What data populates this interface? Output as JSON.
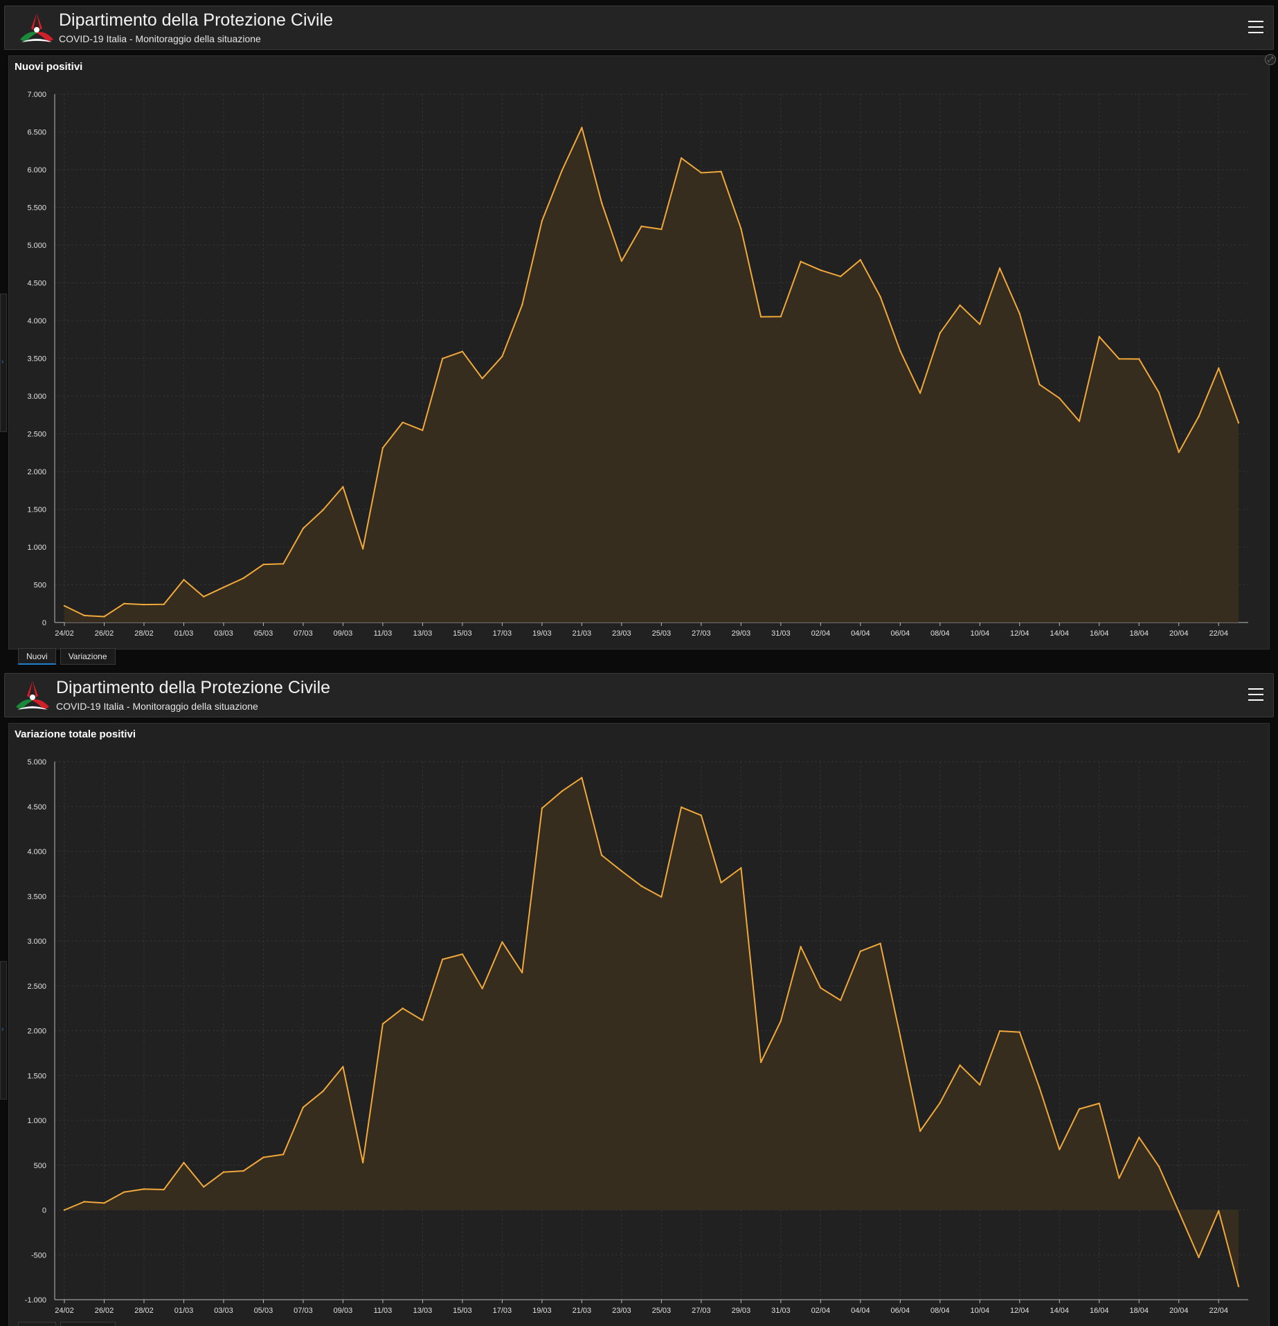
{
  "header": {
    "title": "Dipartimento della Protezione Civile",
    "subtitle": "COVID-19 Italia - Monitoraggio della situazione"
  },
  "tabs": [
    {
      "label": "Nuovi",
      "active": true
    },
    {
      "label": "Variazione",
      "active": false
    }
  ],
  "colors": {
    "line": "#f2a93b",
    "fill": "#3a2f1f",
    "background": "#212121",
    "grid": "#333333",
    "tab_active": "#1d7fd0"
  },
  "chart_data": [
    {
      "type": "area",
      "title": "Nuovi positivi",
      "xlabel": "",
      "ylabel": "",
      "ylim": [
        0,
        7000
      ],
      "ytick_step": 500,
      "grid": true,
      "x": [
        "24/02",
        "25/02",
        "26/02",
        "27/02",
        "28/02",
        "29/02",
        "01/03",
        "02/03",
        "03/03",
        "04/03",
        "05/03",
        "06/03",
        "07/03",
        "08/03",
        "09/03",
        "10/03",
        "11/03",
        "12/03",
        "13/03",
        "14/03",
        "15/03",
        "16/03",
        "17/03",
        "18/03",
        "19/03",
        "20/03",
        "21/03",
        "22/03",
        "23/03",
        "24/03",
        "25/03",
        "26/03",
        "27/03",
        "28/03",
        "29/03",
        "30/03",
        "31/03",
        "01/04",
        "02/04",
        "03/04",
        "04/04",
        "05/04",
        "06/04",
        "07/04",
        "08/04",
        "09/04",
        "10/04",
        "11/04",
        "12/04",
        "13/04",
        "14/04",
        "15/04",
        "16/04",
        "17/04",
        "18/04",
        "19/04",
        "20/04",
        "21/04",
        "22/04",
        "23/04"
      ],
      "xticklabels": [
        "24/02",
        "26/02",
        "28/02",
        "01/03",
        "03/03",
        "05/03",
        "07/03",
        "09/03",
        "11/03",
        "13/03",
        "15/03",
        "17/03",
        "19/03",
        "21/03",
        "23/03",
        "25/03",
        "27/03",
        "29/03",
        "31/03",
        "02/04",
        "04/04",
        "06/04",
        "08/04",
        "10/04",
        "12/04",
        "14/04",
        "16/04",
        "18/04",
        "20/04",
        "22/04"
      ],
      "series": [
        {
          "values": [
            221,
            93,
            78,
            250,
            238,
            240,
            566,
            342,
            466,
            587,
            769,
            778,
            1247,
            1492,
            1797,
            977,
            2313,
            2651,
            2547,
            3497,
            3590,
            3233,
            3526,
            4207,
            5322,
            5986,
            6557,
            5560,
            4789,
            5249,
            5210,
            6153,
            5959,
            5974,
            5217,
            4050,
            4053,
            4782,
            4668,
            4585,
            4805,
            4316,
            3599,
            3039,
            3836,
            4204,
            3951,
            4694,
            4092,
            3153,
            2972,
            2667,
            3786,
            3493,
            3491,
            3047,
            2256,
            2729,
            3370,
            2646
          ]
        }
      ]
    },
    {
      "type": "area",
      "title": "Variazione totale positivi",
      "xlabel": "",
      "ylabel": "",
      "ylim": [
        -1000,
        5000
      ],
      "ytick_step": 500,
      "grid": true,
      "x": [
        "24/02",
        "25/02",
        "26/02",
        "27/02",
        "28/02",
        "29/02",
        "01/03",
        "02/03",
        "03/03",
        "04/03",
        "05/03",
        "06/03",
        "07/03",
        "08/03",
        "09/03",
        "10/03",
        "11/03",
        "12/03",
        "13/03",
        "14/03",
        "15/03",
        "16/03",
        "17/03",
        "18/03",
        "19/03",
        "20/03",
        "21/03",
        "22/03",
        "23/03",
        "24/03",
        "25/03",
        "26/03",
        "27/03",
        "28/03",
        "29/03",
        "30/03",
        "31/03",
        "01/04",
        "02/04",
        "03/04",
        "04/04",
        "05/04",
        "06/04",
        "07/04",
        "08/04",
        "09/04",
        "10/04",
        "11/04",
        "12/04",
        "13/04",
        "14/04",
        "15/04",
        "16/04",
        "17/04",
        "18/04",
        "19/04",
        "20/04",
        "21/04",
        "22/04",
        "23/04"
      ],
      "xticklabels": [
        "24/02",
        "26/02",
        "28/02",
        "01/03",
        "03/03",
        "05/03",
        "07/03",
        "09/03",
        "11/03",
        "13/03",
        "15/03",
        "17/03",
        "19/03",
        "21/03",
        "23/03",
        "25/03",
        "27/03",
        "29/03",
        "31/03",
        "02/04",
        "04/04",
        "06/04",
        "08/04",
        "10/04",
        "12/04",
        "14/04",
        "16/04",
        "18/04",
        "20/04",
        "22/04"
      ],
      "series": [
        {
          "values": [
            0,
            93,
            78,
            200,
            233,
            228,
            528,
            258,
            423,
            436,
            587,
            620,
            1145,
            1326,
            1598,
            529,
            2076,
            2249,
            2116,
            2795,
            2853,
            2470,
            2989,
            2648,
            4480,
            4670,
            4821,
            3957,
            3780,
            3612,
            3491,
            4492,
            4401,
            3651,
            3815,
            1648,
            2107,
            2937,
            2477,
            2339,
            2886,
            2972,
            1941,
            880,
            1195,
            1615,
            1396,
            1996,
            1984,
            1363,
            675,
            1127,
            1189,
            355,
            809,
            486,
            -20,
            -528,
            -10,
            -851
          ]
        }
      ]
    }
  ]
}
